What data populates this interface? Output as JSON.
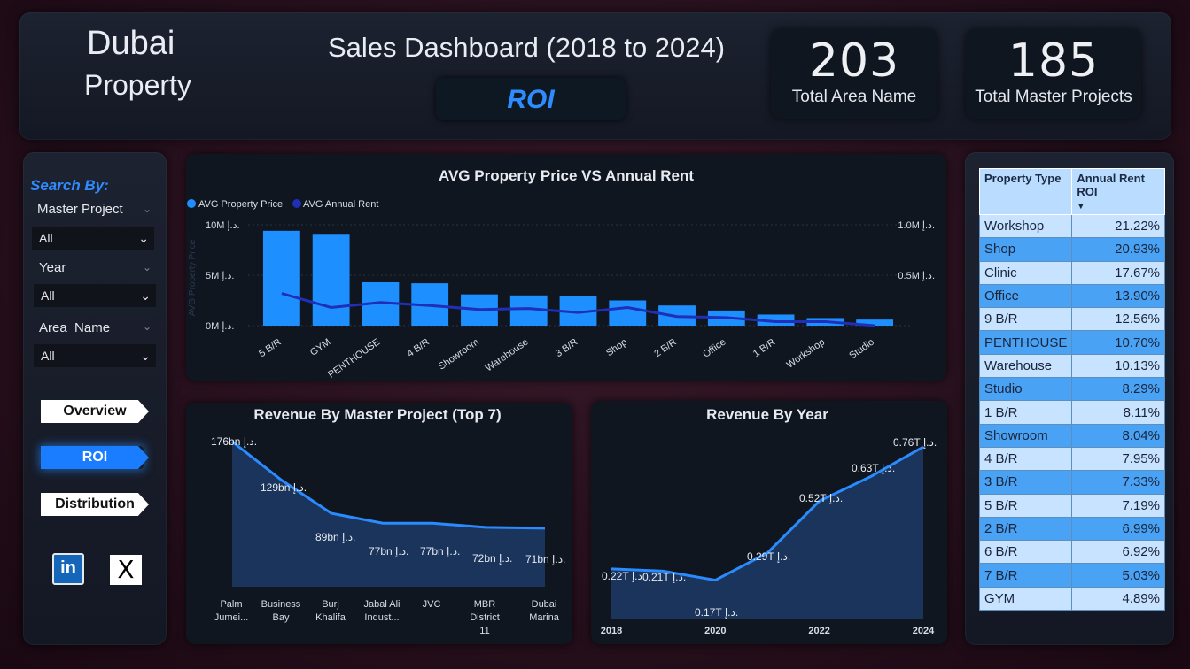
{
  "header": {
    "brand_line1": "Dubai",
    "brand_line2": "Property",
    "title": "Sales Dashboard (2018 to 2024)",
    "page_label": "ROI",
    "kpis": [
      {
        "value": "203",
        "label": "Total Area  Name"
      },
      {
        "value": "185",
        "label": "Total Master Projects"
      }
    ]
  },
  "sidebar": {
    "search_by": "Search By:",
    "slicers": [
      {
        "label": "Master Project",
        "value": "All"
      },
      {
        "label": "Year",
        "value": "All"
      },
      {
        "label": "Area_Name",
        "value": "All"
      }
    ],
    "nav": {
      "overview": "Overview",
      "roi": "ROI",
      "distribution": "Distribution"
    },
    "social": {
      "linkedin": "in",
      "x": "X"
    }
  },
  "colors": {
    "accent": "#2f8cff",
    "bar": "#1e8fff",
    "rent_line": "#1f2fb8",
    "revenue_line": "#2a8bff",
    "table_header": "#b9dcff",
    "table_light": "#c7e3ff",
    "table_dark": "#4aa2f5"
  },
  "chart_data": [
    {
      "type": "bar",
      "title": "AVG Property Price VS Annual Rent",
      "legend": [
        "AVG Property Price",
        "AVG Annual Rent"
      ],
      "legend_position": "top-left",
      "ylabel_left": "AVG Property Price",
      "y_ticks_left": [
        "0M د.إ.",
        "5M د.إ.",
        "10M د.إ."
      ],
      "y_ticks_right": [
        "0.5M د.إ.",
        "1.0M د.إ."
      ],
      "ylim_left": [
        0,
        10
      ],
      "ylim_right": [
        0,
        1.0
      ],
      "categories": [
        "5 B/R",
        "GYM",
        "PENTHOUSE",
        "4 B/R",
        "Showroom",
        "Warehouse",
        "3 B/R",
        "Shop",
        "2 B/R",
        "Office",
        "1 B/R",
        "Workshop",
        "Studio"
      ],
      "series": [
        {
          "name": "AVG Property Price",
          "unit": "M",
          "values": [
            9.4,
            9.1,
            4.3,
            4.2,
            3.1,
            3.0,
            2.9,
            2.5,
            2.0,
            1.5,
            1.1,
            0.75,
            0.6
          ]
        },
        {
          "name": "AVG Annual Rent",
          "unit": "M",
          "values": [
            0.32,
            0.18,
            0.23,
            0.2,
            0.16,
            0.17,
            0.13,
            0.18,
            0.09,
            0.08,
            0.04,
            0.04,
            0.0
          ]
        }
      ]
    },
    {
      "type": "area",
      "title": "Revenue By Master Project (Top 7)",
      "categories": [
        "Palm Jumei...",
        "Business Bay",
        "Burj Khalifa",
        "Jabal Ali Indust...",
        "JVC",
        "MBR District 11",
        "Dubai Marina"
      ],
      "values": [
        176,
        129,
        89,
        77,
        77,
        72,
        71
      ],
      "labels": [
        "176bn د.إ.",
        "129bn د.إ.",
        "89bn د.إ.",
        "77bn د.إ.",
        "77bn د.إ.",
        "72bn د.إ.",
        "71bn د.إ."
      ],
      "ylim": [
        0,
        176
      ]
    },
    {
      "type": "area",
      "title": "Revenue By Year",
      "x": [
        2018,
        2019,
        2020,
        2021,
        2022,
        2023,
        2024
      ],
      "x_ticks": [
        "2018",
        "2020",
        "2022",
        "2024"
      ],
      "values": [
        0.22,
        0.21,
        0.17,
        0.29,
        0.52,
        0.63,
        0.76
      ],
      "labels": [
        "0.22T د.إ.",
        "0.21T د.إ.",
        "0.17T د.إ.",
        "0.29T د.إ.",
        "0.52T د.إ.",
        "0.63T د.إ.",
        "0.76T د.إ."
      ],
      "ylim": [
        0,
        0.76
      ]
    },
    {
      "type": "table",
      "columns": [
        "Property Type",
        "Annual Rent ROI"
      ],
      "sort_indicator": "descending",
      "rows": [
        [
          "Workshop",
          "21.22%"
        ],
        [
          "Shop",
          "20.93%"
        ],
        [
          "Clinic",
          "17.67%"
        ],
        [
          "Office",
          "13.90%"
        ],
        [
          "9 B/R",
          "12.56%"
        ],
        [
          "PENTHOUSE",
          "10.70%"
        ],
        [
          "Warehouse",
          "10.13%"
        ],
        [
          "Studio",
          "8.29%"
        ],
        [
          "1 B/R",
          "8.11%"
        ],
        [
          "Showroom",
          "8.04%"
        ],
        [
          "4 B/R",
          "7.95%"
        ],
        [
          "3 B/R",
          "7.33%"
        ],
        [
          "5 B/R",
          "7.19%"
        ],
        [
          "2 B/R",
          "6.99%"
        ],
        [
          "6 B/R",
          "6.92%"
        ],
        [
          "7 B/R",
          "5.03%"
        ],
        [
          "GYM",
          "4.89%"
        ]
      ]
    }
  ]
}
